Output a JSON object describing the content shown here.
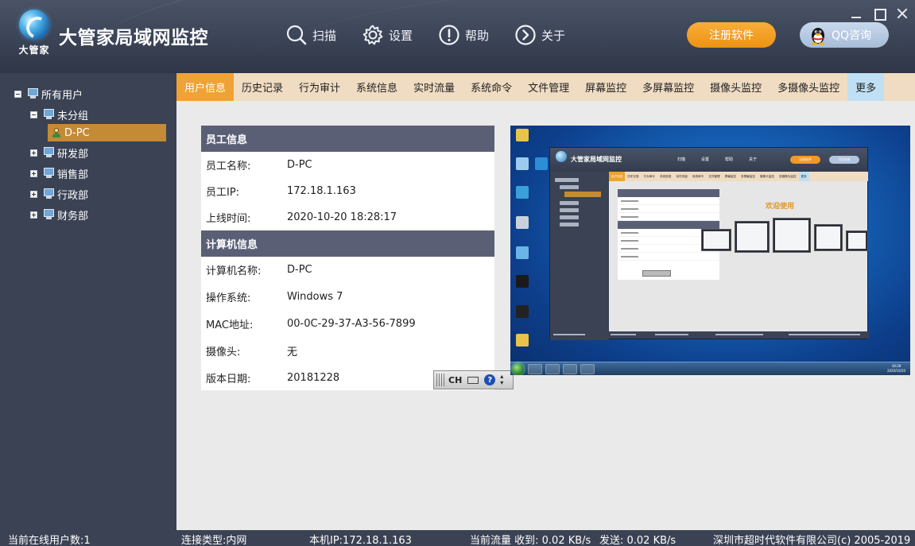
{
  "app": {
    "title": "大管家局域网监控",
    "logo_text": "大管家"
  },
  "header": {
    "nav": [
      {
        "label": "扫描",
        "icon": "search-icon"
      },
      {
        "label": "设置",
        "icon": "gear-icon"
      },
      {
        "label": "帮助",
        "icon": "exclamation-icon"
      },
      {
        "label": "关于",
        "icon": "chevron-right-circle-icon"
      }
    ],
    "register_label": "注册软件",
    "qq_label": "QQ咨询"
  },
  "tree": {
    "root": "所有用户",
    "groups": [
      {
        "label": "未分组",
        "expanded": true
      },
      {
        "label": "研发部",
        "expanded": false
      },
      {
        "label": "销售部",
        "expanded": false
      },
      {
        "label": "行政部",
        "expanded": false
      },
      {
        "label": "财务部",
        "expanded": false
      }
    ],
    "selected_user": "D-PC"
  },
  "tabs": [
    {
      "label": "用户信息",
      "active": true
    },
    {
      "label": "历史记录"
    },
    {
      "label": "行为审计"
    },
    {
      "label": "系统信息"
    },
    {
      "label": "实时流量"
    },
    {
      "label": "系统命令"
    },
    {
      "label": "文件管理"
    },
    {
      "label": "屏幕监控"
    },
    {
      "label": "多屏幕监控"
    },
    {
      "label": "摄像头监控"
    },
    {
      "label": "多摄像头监控"
    },
    {
      "label": "更多"
    }
  ],
  "employee": {
    "section_title": "员工信息",
    "rows": [
      {
        "label": "员工名称:",
        "value": "D-PC"
      },
      {
        "label": "员工IP:",
        "value": "172.18.1.163"
      },
      {
        "label": "上线时间:",
        "value": "2020-10-20 18:28:17"
      }
    ]
  },
  "computer": {
    "section_title": "计算机信息",
    "rows": [
      {
        "label": "计算机名称:",
        "value": "D-PC"
      },
      {
        "label": "操作系统:",
        "value": "Windows 7"
      },
      {
        "label": "MAC地址:",
        "value": "00-0C-29-37-A3-56-7899"
      },
      {
        "label": "摄像头:",
        "value": "无"
      },
      {
        "label": "版本日期:",
        "value": "20181228"
      }
    ]
  },
  "ime": {
    "lang": "CH",
    "help": "?"
  },
  "remote_screen": {
    "window_title": "大管家局域网监控",
    "nav": [
      "扫描",
      "设置",
      "帮助",
      "关于"
    ],
    "register_label": "注册软件",
    "qq_label": "QQ咨询",
    "tabs": [
      "用户信息",
      "历史记录",
      "行为审计",
      "系统信息",
      "实时流量",
      "系统命令",
      "文件管理",
      "屏幕监控",
      "多屏幕监控",
      "摄像头监控",
      "多摄像头监控",
      "更多"
    ],
    "welcome": "欢迎使用",
    "clock_time": "18:28",
    "clock_date": "2020/10/20"
  },
  "status": {
    "online_users": "当前在线用户数:1",
    "connection": "连接类型:内网",
    "local_ip": "本机IP:172.18.1.163",
    "traffic_recv": "当前流量 收到: 0.02 KB/s",
    "traffic_send": "发送: 0.02 KB/s",
    "copyright": "深圳市超时代软件有限公司(c) 2005-2019"
  },
  "colors": {
    "header_bg": "#3b4356",
    "accent_orange": "#efa235",
    "register_button": "#f19a1f",
    "section_header": "#5b5f76",
    "selected_node": "#c48a35",
    "tab_bar": "#f0dcc2",
    "more_tab": "#bfe0f4"
  }
}
